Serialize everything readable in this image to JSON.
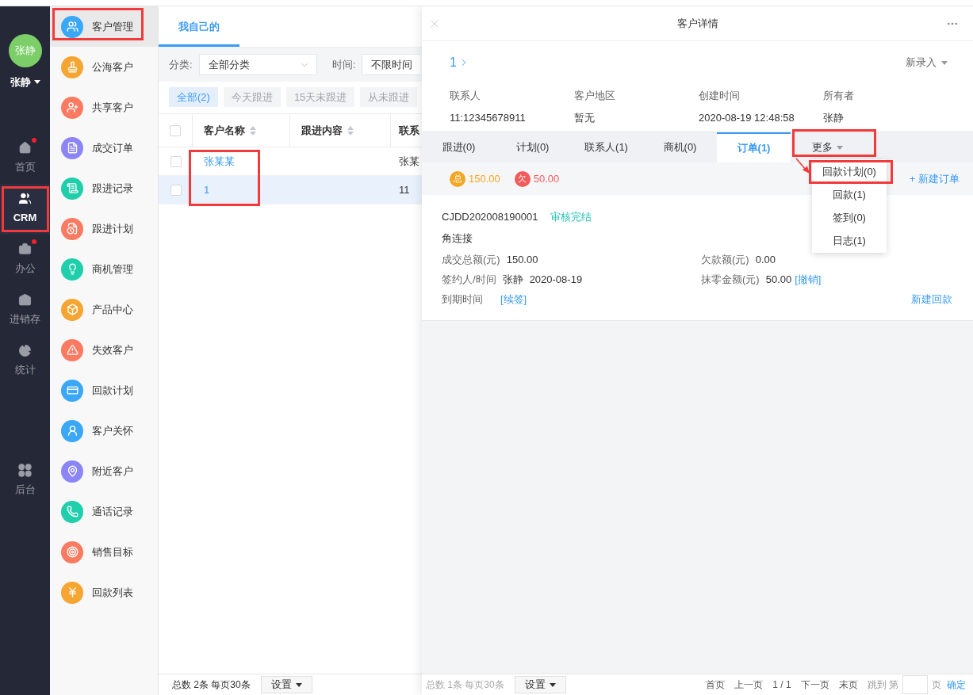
{
  "nav": {
    "avatar": "张静",
    "user": "张静",
    "items": [
      {
        "label": "首页",
        "selected": false,
        "badge": true,
        "highlighted": false
      },
      {
        "label": "CRM",
        "selected": true,
        "badge": false,
        "highlighted": true
      },
      {
        "label": "办公",
        "selected": false,
        "badge": true,
        "highlighted": false
      },
      {
        "label": "进销存",
        "selected": false,
        "badge": false,
        "highlighted": false
      },
      {
        "label": "统计",
        "selected": false,
        "badge": false,
        "highlighted": false
      }
    ],
    "bottom_items": [
      {
        "label": "后台",
        "selected": false,
        "badge": false,
        "highlighted": false
      }
    ]
  },
  "menu": {
    "items": [
      {
        "label": "客户管理",
        "selected": true,
        "highlighted": true,
        "color": "#3aa8f6"
      },
      {
        "label": "公海客户",
        "selected": false,
        "highlighted": false,
        "color": "#f6a532"
      },
      {
        "label": "共享客户",
        "selected": false,
        "highlighted": false,
        "color": "#fb7a62"
      },
      {
        "label": "成交订单",
        "selected": false,
        "highlighted": false,
        "color": "#8b85f8"
      },
      {
        "label": "跟进记录",
        "selected": false,
        "highlighted": false,
        "color": "#1fcfab"
      },
      {
        "label": "跟进计划",
        "selected": false,
        "highlighted": false,
        "color": "#fb7a62"
      },
      {
        "label": "商机管理",
        "selected": false,
        "highlighted": false,
        "color": "#1fcfab"
      },
      {
        "label": "产品中心",
        "selected": false,
        "highlighted": false,
        "color": "#f6a532"
      },
      {
        "label": "失效客户",
        "selected": false,
        "highlighted": false,
        "color": "#fb7a62"
      },
      {
        "label": "回款计划",
        "selected": false,
        "highlighted": false,
        "color": "#3aa8f6"
      },
      {
        "label": "客户关怀",
        "selected": false,
        "highlighted": false,
        "color": "#3aa8f6"
      },
      {
        "label": "附近客户",
        "selected": false,
        "highlighted": false,
        "color": "#8b85f8"
      },
      {
        "label": "通话记录",
        "selected": false,
        "highlighted": false,
        "color": "#1fcfab"
      },
      {
        "label": "销售目标",
        "selected": false,
        "highlighted": false,
        "color": "#fb7a62"
      },
      {
        "label": "回款列表",
        "selected": false,
        "highlighted": false,
        "color": "#f6a532"
      }
    ]
  },
  "list_panel": {
    "tabs": [
      {
        "label": "我自己的",
        "selected": true
      }
    ],
    "filters": [
      {
        "label": "分类:",
        "value": "全部分类"
      },
      {
        "label": "时间:",
        "value": "不限时间"
      }
    ],
    "quick_filters": [
      {
        "label": "全部(2)",
        "selected": true
      },
      {
        "label": "今天跟进",
        "selected": false
      },
      {
        "label": "15天未跟进",
        "selected": false
      },
      {
        "label": "从未跟进",
        "selected": false
      }
    ],
    "table": {
      "all_checked": false,
      "columns": [
        {
          "label": "客户名称",
          "sortable": true,
          "highlighted": true
        },
        {
          "label": "跟进内容",
          "sortable": true,
          "highlighted": false
        },
        {
          "label": "联系",
          "sortable": false,
          "highlighted": false
        }
      ],
      "rows": [
        {
          "name": "张某某",
          "contact": "张某",
          "checked": false,
          "selected": false
        },
        {
          "name": "1",
          "contact": "11",
          "checked": false,
          "selected": true
        }
      ]
    },
    "footer": {
      "total": "总数 2条 每页30条",
      "settings": "设置"
    }
  },
  "detail": {
    "title": "客户详情",
    "customer": "1",
    "new_entry": "新录入",
    "fields": [
      {
        "label": "联系人",
        "value": "11:12345678911"
      },
      {
        "label": "客户地区",
        "value": "暂无"
      },
      {
        "label": "创建时间",
        "value": "2020-08-19 12:48:58"
      },
      {
        "label": "所有者",
        "value": "张静"
      }
    ],
    "tabs": [
      {
        "label": "跟进(0)",
        "kind": "tab",
        "selected": false,
        "highlighted": false
      },
      {
        "label": "计划(0)",
        "kind": "tab",
        "selected": false,
        "highlighted": false
      },
      {
        "label": "联系人(1)",
        "kind": "tab",
        "selected": false,
        "highlighted": false
      },
      {
        "label": "商机(0)",
        "kind": "tab",
        "selected": false,
        "highlighted": false
      },
      {
        "label": "订单(1)",
        "kind": "tab",
        "selected": true,
        "highlighted": false
      },
      {
        "label": "更多",
        "kind": "dropdown",
        "selected": false,
        "highlighted": true,
        "expanded": true,
        "menu": [
          {
            "label": "回款计划(0)",
            "highlighted": true
          },
          {
            "label": "回款(1)",
            "highlighted": false
          },
          {
            "label": "签到(0)",
            "highlighted": false
          },
          {
            "label": "日志(1)",
            "highlighted": false
          }
        ]
      }
    ],
    "summary": {
      "total_badge": "总",
      "total": "150.00",
      "owed_badge": "欠",
      "owed": "50.00",
      "new_order": "+ 新建订单"
    },
    "order": {
      "number": "CJDD202008190001",
      "status": "审核完结",
      "product": "角连接",
      "fields": [
        {
          "label": "成交总额(元)",
          "values": [
            "150.00"
          ]
        },
        {
          "label": "欠款额(元)",
          "values": [
            "0.00"
          ]
        },
        {
          "label": "签约人/时间",
          "values": [
            "张静",
            "2020-08-19"
          ]
        },
        {
          "label": "抹零金额(元)",
          "values": [
            "50.00"
          ],
          "link": "[撤销]"
        },
        {
          "label": "到期时间",
          "link": "[续签]"
        }
      ],
      "new_payment": "新建回款"
    },
    "footer": {
      "total": "总数 1条 每页30条",
      "settings": "设置",
      "first": "首页",
      "previous": "上一页",
      "page": "1 / 1",
      "next": "下一页",
      "last": "末页",
      "jump_label": "跳到 第",
      "page_unit": "页",
      "confirm": "确定"
    }
  }
}
